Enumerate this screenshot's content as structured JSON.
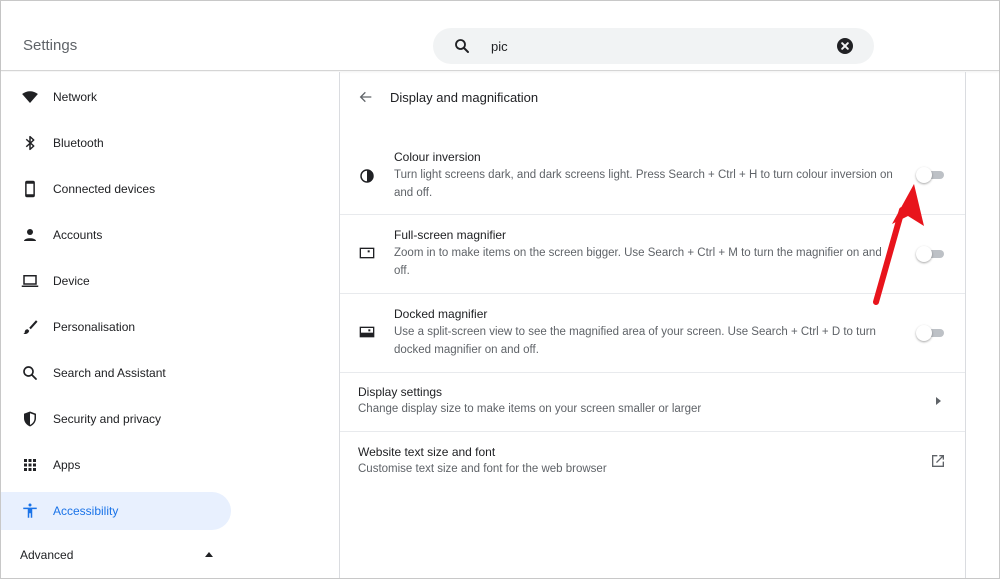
{
  "header": {
    "title": "Settings",
    "search": {
      "value": "pic",
      "icon": "search-icon",
      "clear_icon": "close-icon"
    }
  },
  "sidebar": {
    "items": [
      {
        "label": "Network",
        "icon": "wifi-icon",
        "active": false
      },
      {
        "label": "Bluetooth",
        "icon": "bluetooth-icon",
        "active": false
      },
      {
        "label": "Connected devices",
        "icon": "phone-icon",
        "active": false
      },
      {
        "label": "Accounts",
        "icon": "person-icon",
        "active": false
      },
      {
        "label": "Device",
        "icon": "laptop-icon",
        "active": false
      },
      {
        "label": "Personalisation",
        "icon": "brush-icon",
        "active": false
      },
      {
        "label": "Search and Assistant",
        "icon": "search-icon",
        "active": false
      },
      {
        "label": "Security and privacy",
        "icon": "shield-icon",
        "active": false
      },
      {
        "label": "Apps",
        "icon": "apps-grid-icon",
        "active": false
      },
      {
        "label": "Accessibility",
        "icon": "accessibility-icon",
        "active": true
      }
    ],
    "advanced_label": "Advanced"
  },
  "main": {
    "page_title": "Display and magnification",
    "settings": [
      {
        "title": "Colour inversion",
        "description": "Turn light screens dark, and dark screens light. Press Search + Ctrl + H to turn colour inversion on and off.",
        "icon": "contrast-icon",
        "enabled": false
      },
      {
        "title": "Full-screen magnifier",
        "description": "Zoom in to make items on the screen bigger. Use Search + Ctrl + M to turn the magnifier on and off.",
        "icon": "fullscreen-magnifier-icon",
        "enabled": false
      },
      {
        "title": "Docked magnifier",
        "description": "Use a split-screen view to see the magnified area of your screen. Use Search + Ctrl + D to turn docked magnifier on and off.",
        "icon": "docked-magnifier-icon",
        "enabled": false
      }
    ],
    "links": [
      {
        "title": "Display settings",
        "description": "Change display size to make items on your screen smaller or larger",
        "icon": "chevron-right-icon"
      },
      {
        "title": "Website text size and font",
        "description": "Customise text size and font for the web browser",
        "icon": "external-link-icon"
      }
    ]
  },
  "colors": {
    "accent": "#1a73e8",
    "active_bg": "#e8f0fe",
    "annotation": "#e8141c"
  }
}
